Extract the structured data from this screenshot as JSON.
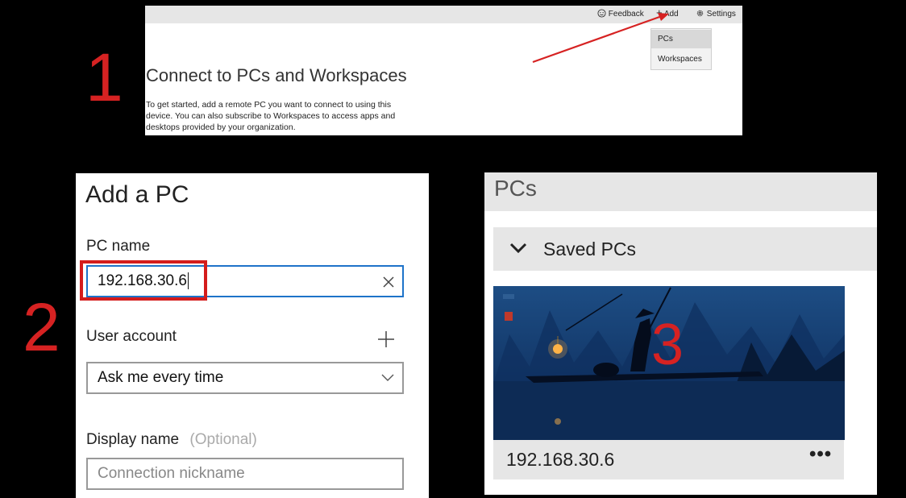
{
  "step_numbers": [
    "1",
    "2",
    "3"
  ],
  "panel1": {
    "toolbar": {
      "feedback_label": "Feedback",
      "add_label": "Add",
      "settings_label": "Settings"
    },
    "add_menu": {
      "items": [
        "PCs",
        "Workspaces"
      ]
    },
    "title": "Connect to PCs and Workspaces",
    "description": "To get started, add a remote PC you want to connect to using this device. You can also subscribe to Workspaces to access apps and desktops provided by your organization."
  },
  "panel2": {
    "title": "Add a PC",
    "pc_name_label": "PC name",
    "pc_name_value": "192.168.30.6",
    "user_account_label": "User account",
    "user_account_value": "Ask me every time",
    "display_name_label": "Display name",
    "display_name_optional": "(Optional)",
    "display_name_placeholder": "Connection nickname"
  },
  "panel3": {
    "title": "PCs",
    "group_label": "Saved PCs",
    "pc_tile_name": "192.168.30.6",
    "more_label": "•••"
  },
  "colors": {
    "annotation_red": "#d62222",
    "accent_blue": "#1e73c9"
  }
}
